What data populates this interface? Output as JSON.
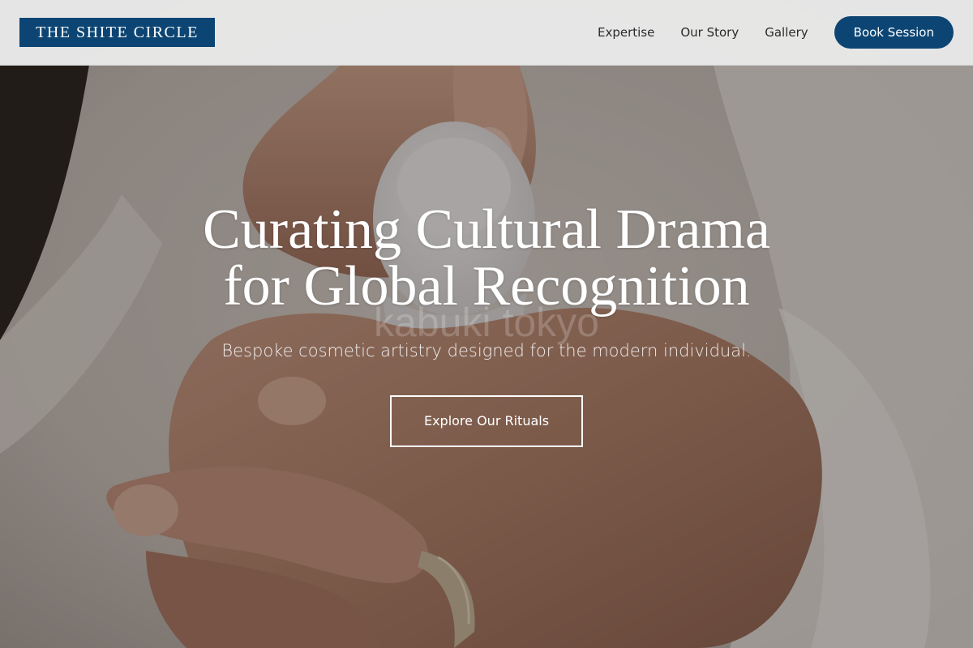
{
  "brand": {
    "logo_text": "THE SHITE CIRCLE",
    "primary_color": "#0c4573"
  },
  "nav": {
    "links": [
      {
        "label": "Expertise"
      },
      {
        "label": "Our Story"
      },
      {
        "label": "Gallery"
      }
    ],
    "cta_label": "Book Session"
  },
  "hero": {
    "title_line1": "Curating Cultural Drama",
    "title_line2": "for Global Recognition",
    "subtitle": "Bespoke cosmetic artistry designed for the modern individual.",
    "cta_label": "Explore Our Rituals",
    "jar_print": "kabuki tokyo",
    "image_subject": "hands-holding-cream-jar-photo"
  }
}
